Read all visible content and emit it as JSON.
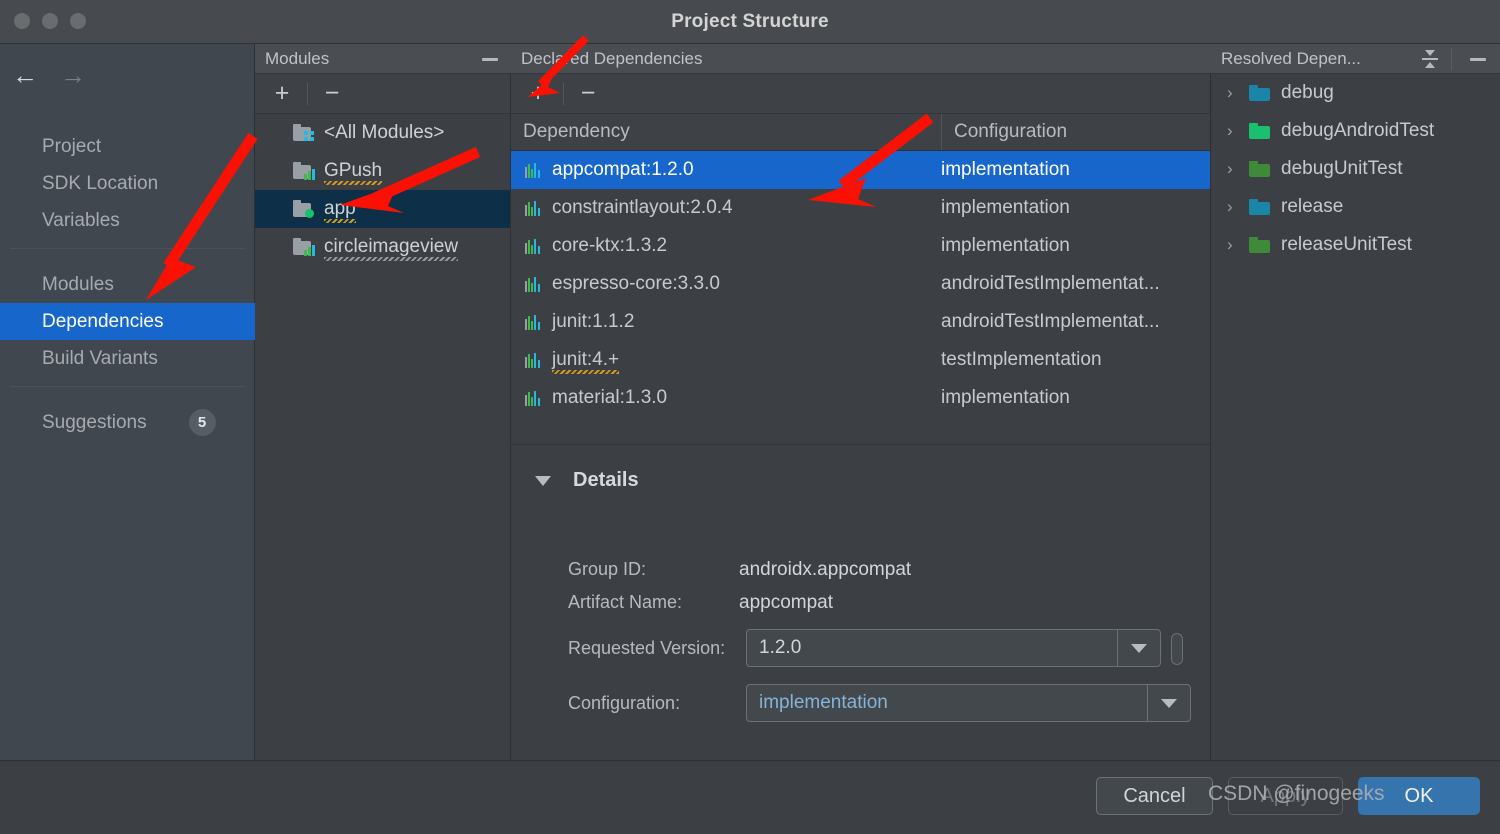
{
  "window": {
    "title": "Project Structure",
    "traffic_lights": [
      "close-dot",
      "minimize-dot",
      "zoom-dot"
    ]
  },
  "nav": {
    "back": "←",
    "forward": "→"
  },
  "sidebar": {
    "items": [
      {
        "label": "Project",
        "selected": false
      },
      {
        "label": "SDK Location",
        "selected": false
      },
      {
        "label": "Variables",
        "selected": false
      },
      {
        "label": "Modules",
        "selected": false
      },
      {
        "label": "Dependencies",
        "selected": true
      },
      {
        "label": "Build Variants",
        "selected": false
      },
      {
        "label": "Suggestions",
        "selected": false,
        "badge": "5"
      }
    ]
  },
  "modules_panel": {
    "title": "Modules",
    "minimize_label": "—",
    "toolbar": {
      "add": "+",
      "remove": "−"
    },
    "items": [
      {
        "label": "<All Modules>",
        "selected": false,
        "icon": "folder-modules-icon"
      },
      {
        "label": "GPush",
        "selected": false,
        "icon": "folder-module-icon"
      },
      {
        "label": "app",
        "selected": true,
        "icon": "folder-app-icon"
      },
      {
        "label": "circleimageview",
        "selected": false,
        "icon": "folder-module-icon"
      }
    ]
  },
  "declared_panel": {
    "title": "Declared Dependencies",
    "toolbar": {
      "add": "+",
      "remove": "−"
    },
    "columns": [
      "Dependency",
      "Configuration"
    ],
    "rows": [
      {
        "dependency": "appcompat:1.2.0",
        "configuration": "implementation",
        "selected": true
      },
      {
        "dependency": "constraintlayout:2.0.4",
        "configuration": "implementation",
        "selected": false
      },
      {
        "dependency": "core-ktx:1.3.2",
        "configuration": "implementation",
        "selected": false
      },
      {
        "dependency": "espresso-core:3.3.0",
        "configuration": "androidTestImplementat...",
        "selected": false
      },
      {
        "dependency": "junit:1.1.2",
        "configuration": "androidTestImplementat...",
        "selected": false
      },
      {
        "dependency": "junit:4.+",
        "configuration": "testImplementation",
        "selected": false
      },
      {
        "dependency": "material:1.3.0",
        "configuration": "implementation",
        "selected": false
      }
    ]
  },
  "details": {
    "title": "Details",
    "expanded": true,
    "group_id_label": "Group ID:",
    "group_id_value": "androidx.appcompat",
    "artifact_label": "Artifact Name:",
    "artifact_value": "appcompat",
    "version_label": "Requested Version:",
    "version_value": "1.2.0",
    "configuration_label": "Configuration:",
    "configuration_value": "implementation"
  },
  "resolved_panel": {
    "title": "Resolved Depen...",
    "minimize_label": "—",
    "items": [
      {
        "label": "debug",
        "color": "#1a85a8"
      },
      {
        "label": "debugAndroidTest",
        "color": "#18c070"
      },
      {
        "label": "debugUnitTest",
        "color": "#3f8a39"
      },
      {
        "label": "release",
        "color": "#1a85a8"
      },
      {
        "label": "releaseUnitTest",
        "color": "#3f8a39"
      }
    ]
  },
  "footer": {
    "cancel": "Cancel",
    "apply": "Apply",
    "ok": "OK"
  },
  "watermark": "CSDN @finogeeks",
  "colors": {
    "accent_selected": "#1766cc",
    "module_selected": "#0d3048",
    "primary_button": "#3574ad",
    "annotation_arrow": "#fa1104",
    "window_bg": "#3c4044",
    "sidebar_bg": "#41474f"
  }
}
